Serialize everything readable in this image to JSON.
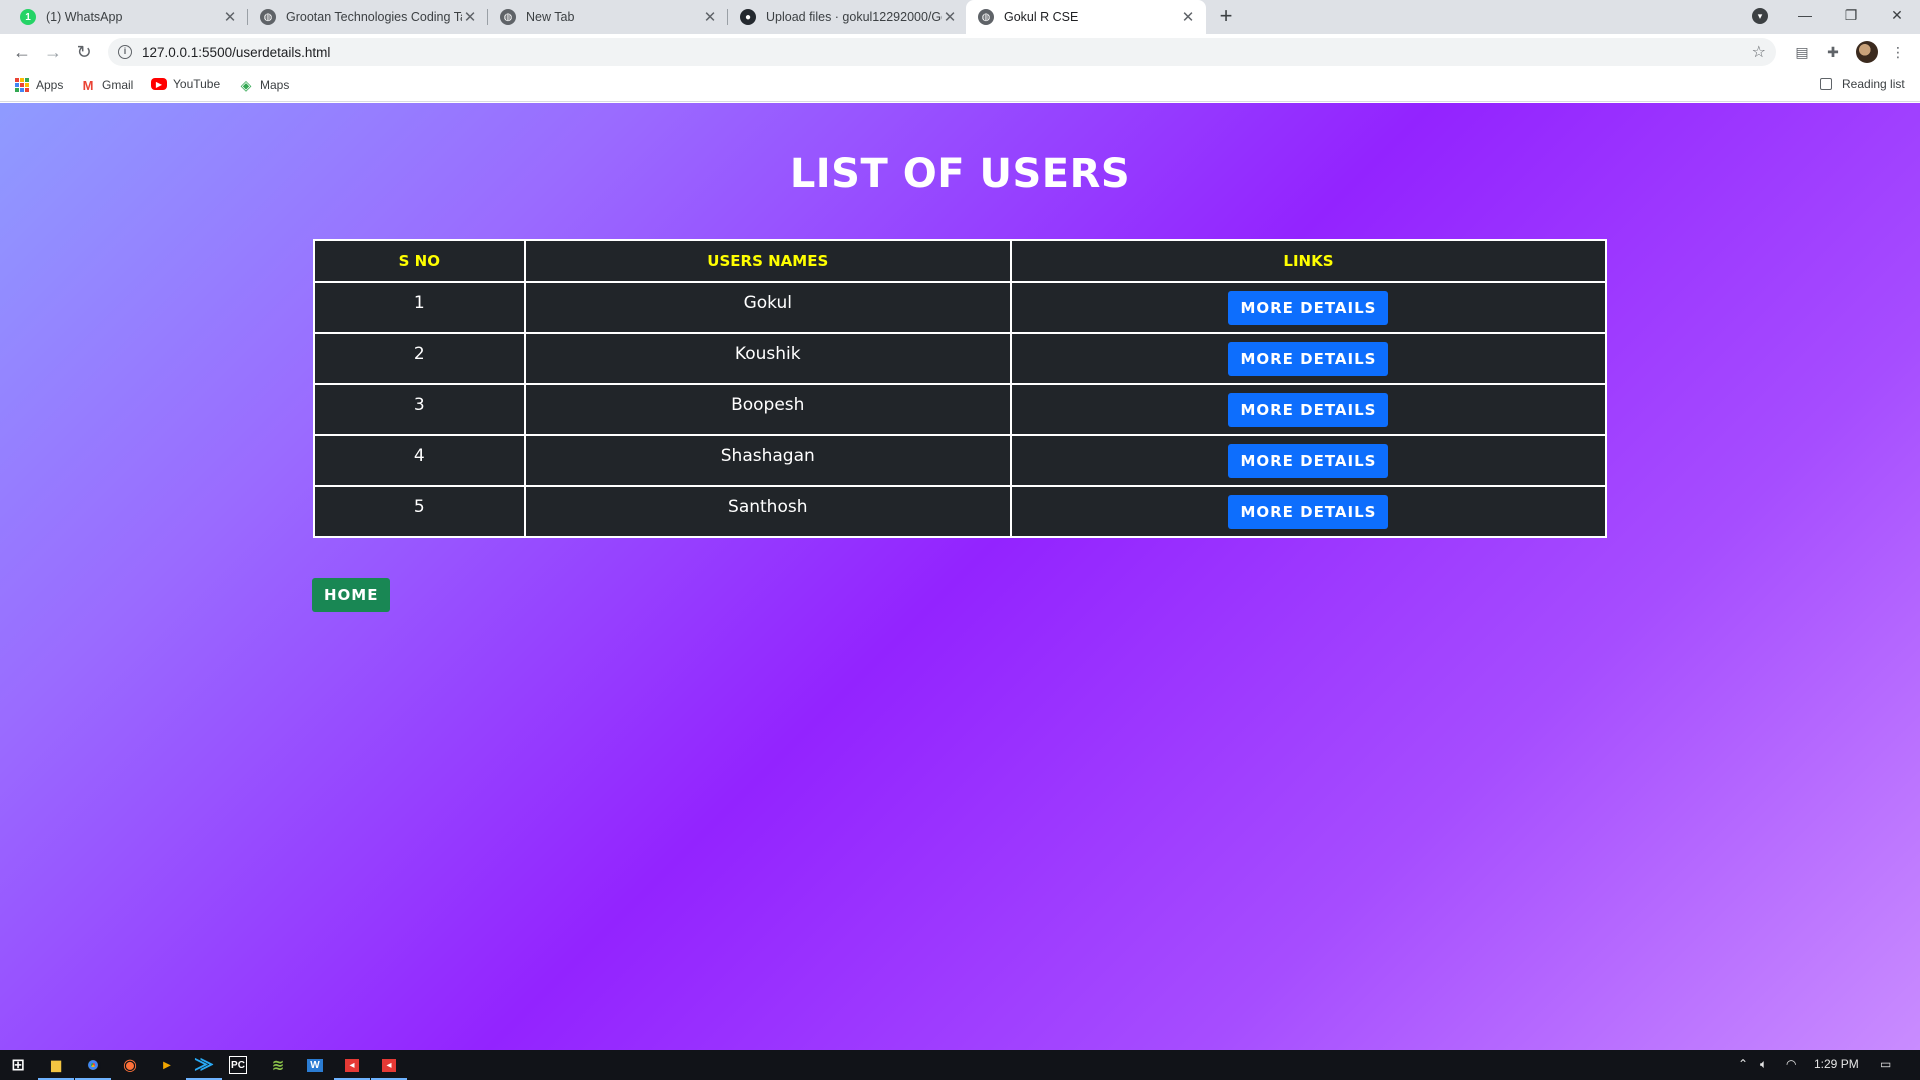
{
  "browser": {
    "tabs": [
      {
        "title": "(1) WhatsApp",
        "icon": "whatsapp-icon",
        "active": false
      },
      {
        "title": "Grootan Technologies Coding Ta",
        "icon": "globe-icon",
        "active": false
      },
      {
        "title": "New Tab",
        "icon": "globe-icon",
        "active": false
      },
      {
        "title": "Upload files · gokul12292000/Go",
        "icon": "github-icon",
        "active": false
      },
      {
        "title": "Gokul R CSE",
        "icon": "globe-icon",
        "active": true
      }
    ],
    "new_tab": "+",
    "address": "127.0.0.1:5500/userdetails.html",
    "bookmarks": [
      {
        "label": "Apps",
        "icon": "apps-grid-icon"
      },
      {
        "label": "Gmail",
        "icon": "gmail-icon"
      },
      {
        "label": "YouTube",
        "icon": "youtube-icon"
      },
      {
        "label": "Maps",
        "icon": "maps-icon"
      }
    ],
    "reading_list": "Reading list"
  },
  "page": {
    "title": "LIST OF USERS",
    "columns": [
      "S NO",
      "USERS NAMES",
      "LINKS"
    ],
    "rows": [
      {
        "sno": "1",
        "name": "Gokul",
        "link": "MORE DETAILS"
      },
      {
        "sno": "2",
        "name": "Koushik",
        "link": "MORE DETAILS"
      },
      {
        "sno": "3",
        "name": "Boopesh",
        "link": "MORE DETAILS"
      },
      {
        "sno": "4",
        "name": "Shashagan",
        "link": "MORE DETAILS"
      },
      {
        "sno": "5",
        "name": "Santhosh",
        "link": "MORE DETAILS"
      }
    ],
    "home_button": "HOME"
  },
  "taskbar": {
    "clock": "1:29 PM"
  },
  "colors": {
    "header_text": "#ffff00",
    "table_bg": "#212529",
    "more_button": "#0d6efd",
    "home_button": "#198754"
  }
}
